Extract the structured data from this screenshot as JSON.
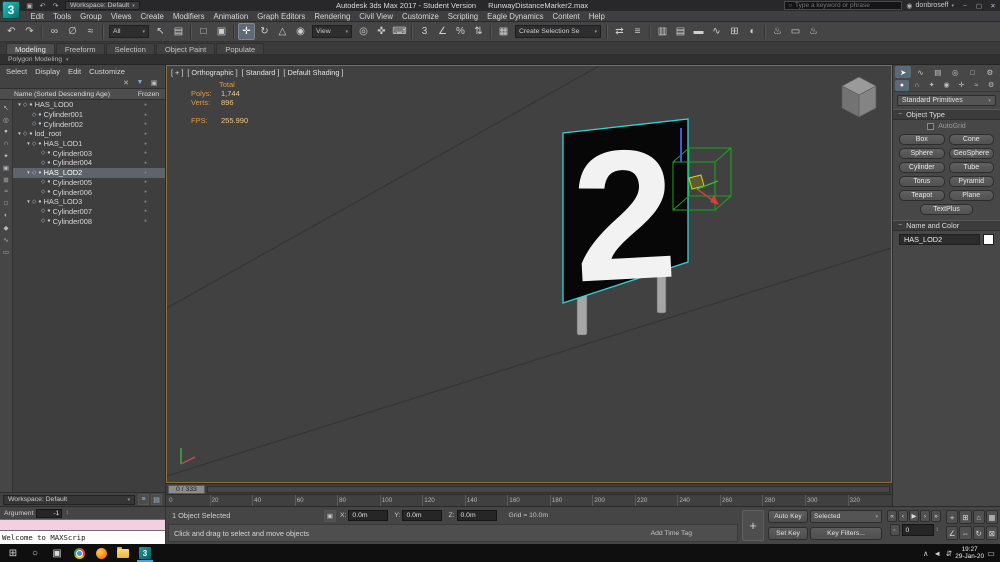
{
  "title_bar": {
    "logo_text": "3",
    "qat_icons": [
      {
        "name": "save-icon",
        "glyph": "▣"
      },
      {
        "name": "undo-quick-icon",
        "glyph": "↶"
      },
      {
        "name": "redo-quick-icon",
        "glyph": "↷"
      }
    ],
    "workspace_label": "Workspace: Default",
    "app_title": "Autodesk 3ds Max 2017 - Student Version",
    "doc_title": "RunwayDistanceMarker2.max",
    "search_placeholder": "Type a keyword or phrase",
    "user_name": "donbroseff",
    "window_controls": [
      {
        "name": "minimize-button",
        "glyph": "–"
      },
      {
        "name": "maximize-button",
        "glyph": "▢"
      },
      {
        "name": "close-button",
        "glyph": "✕"
      }
    ]
  },
  "menu_bar": {
    "items": [
      "Edit",
      "Tools",
      "Group",
      "Views",
      "Create",
      "Modifiers",
      "Animation",
      "Graph Editors",
      "Rendering",
      "Civil View",
      "Customize",
      "Scripting",
      "Eagle Dynamics",
      "Content",
      "Help"
    ]
  },
  "toolbar": {
    "items": [
      {
        "name": "undo-icon",
        "glyph": "↶"
      },
      {
        "name": "redo-icon",
        "glyph": "↷"
      },
      {
        "sep": true
      },
      {
        "name": "select-and-link-icon",
        "glyph": "∞"
      },
      {
        "name": "unlink-selection-icon",
        "glyph": "∅"
      },
      {
        "name": "bind-to-space-warp-icon",
        "glyph": "≈"
      },
      {
        "sep": true
      },
      {
        "name": "selection-filter-dropdown",
        "text": "All",
        "dropdown": true
      },
      {
        "name": "select-object-icon",
        "glyph": "↖"
      },
      {
        "name": "select-by-name-icon",
        "glyph": "▤"
      },
      {
        "sep": true
      },
      {
        "name": "selection-region-icon",
        "glyph": "□"
      },
      {
        "name": "window-crossing-icon",
        "glyph": "▣"
      },
      {
        "sep": true
      },
      {
        "name": "select-and-move-icon",
        "glyph": "✛",
        "active": true
      },
      {
        "name": "select-and-rotate-icon",
        "glyph": "↻"
      },
      {
        "name": "select-and-scale-icon",
        "glyph": "△"
      },
      {
        "name": "select-and-place-icon",
        "glyph": "◉"
      },
      {
        "name": "reference-coordinate-dropdown",
        "text": "View",
        "dropdown": true
      },
      {
        "name": "use-pivot-center-icon",
        "glyph": "◎"
      },
      {
        "name": "select-and-manipulate-icon",
        "glyph": "✜"
      },
      {
        "name": "keyboard-shortcut-override-icon",
        "glyph": "⌨"
      },
      {
        "sep": true
      },
      {
        "name": "snaps-toggle-icon",
        "glyph": "3"
      },
      {
        "name": "angle-snap-icon",
        "glyph": "∠"
      },
      {
        "name": "percent-snap-icon",
        "glyph": "%"
      },
      {
        "name": "spinner-snap-icon",
        "glyph": "⇅"
      },
      {
        "sep": true
      },
      {
        "name": "edit-named-selection-sets-icon",
        "glyph": "▦"
      },
      {
        "name": "named-selection-sets-dropdown",
        "text": "Create Selection Se",
        "dropdown": true,
        "wide": true
      },
      {
        "sep": true
      },
      {
        "name": "mirror-icon",
        "glyph": "⇄"
      },
      {
        "name": "align-icon",
        "glyph": "≡"
      },
      {
        "sep": true
      },
      {
        "name": "toggle-scene-explorer-icon",
        "glyph": "▥"
      },
      {
        "name": "toggle-layer-explorer-icon",
        "glyph": "▤"
      },
      {
        "name": "toggle-ribbon-icon",
        "glyph": "▬"
      },
      {
        "name": "curve-editor-icon",
        "glyph": "∿"
      },
      {
        "name": "schematic-view-icon",
        "glyph": "⊞"
      },
      {
        "name": "material-editor-icon",
        "glyph": "◐"
      },
      {
        "sep": true
      },
      {
        "name": "render-setup-icon",
        "glyph": "♨"
      },
      {
        "name": "rendered-frame-window-icon",
        "glyph": "▭"
      },
      {
        "name": "render-production-icon",
        "glyph": "♨"
      }
    ]
  },
  "ribbon": {
    "tabs": [
      {
        "label": "Modeling",
        "active": true
      },
      {
        "label": "Freeform"
      },
      {
        "label": "Selection"
      },
      {
        "label": "Object Paint"
      },
      {
        "label": "Populate"
      }
    ],
    "panel_strip": "Polygon Modeling"
  },
  "scene_explorer": {
    "menus": [
      "Select",
      "Display",
      "Edit",
      "Customize"
    ],
    "tools": [
      {
        "name": "clear-filter-icon",
        "glyph": "✕"
      },
      {
        "name": "filter-combinations-icon",
        "glyph": "▼"
      },
      {
        "name": "lock-explorer-icon",
        "glyph": "▣"
      }
    ],
    "header_name": "Name (Sorted Descending Age)",
    "header_frozen": "Frozen",
    "side_icons": [
      {
        "name": "explorer-select-icon",
        "glyph": "↖"
      },
      {
        "name": "explorer-find-icon",
        "glyph": "◎"
      },
      {
        "name": "display-geometry-icon",
        "glyph": "●"
      },
      {
        "name": "display-shapes-icon",
        "glyph": "∩"
      },
      {
        "name": "display-lights-icon",
        "glyph": "✦"
      },
      {
        "name": "display-cameras-icon",
        "glyph": "▣"
      },
      {
        "name": "display-helpers-icon",
        "glyph": "⊞"
      },
      {
        "name": "display-spacewarps-icon",
        "glyph": "≈"
      },
      {
        "name": "display-groups-icon",
        "glyph": "□"
      },
      {
        "name": "display-xrefs-icon",
        "glyph": "◐"
      },
      {
        "name": "display-materials-icon",
        "glyph": "◆"
      },
      {
        "name": "display-bones-icon",
        "glyph": "∿"
      },
      {
        "name": "display-containers-icon",
        "glyph": "▭"
      }
    ],
    "items": [
      {
        "label": "HAS_LOD0",
        "depth": 0,
        "parent": true
      },
      {
        "label": "Cylinder001",
        "depth": 1
      },
      {
        "label": "Cylinder002",
        "depth": 1
      },
      {
        "label": "lod_root",
        "depth": 0,
        "parent": true
      },
      {
        "label": "HAS_LOD1",
        "depth": 1,
        "parent": true
      },
      {
        "label": "Cylinder003",
        "depth": 2
      },
      {
        "label": "Cylinder004",
        "depth": 2
      },
      {
        "label": "HAS_LOD2",
        "depth": 1,
        "parent": true,
        "selected": true
      },
      {
        "label": "Cylinder005",
        "depth": 2
      },
      {
        "label": "Cylinder006",
        "depth": 2
      },
      {
        "label": "HAS_LOD3",
        "depth": 1,
        "parent": true
      },
      {
        "label": "Cylinder007",
        "depth": 2
      },
      {
        "label": "Cylinder008",
        "depth": 2
      }
    ]
  },
  "viewport": {
    "label_segments": [
      {
        "name": "viewport-general-menu",
        "text": "[ + ]"
      },
      {
        "name": "viewport-pov-menu",
        "text": "[ Orthographic ]"
      },
      {
        "name": "viewport-renderer-menu",
        "text": "[ Standard ]"
      },
      {
        "name": "viewport-shading-menu",
        "text": "[ Default Shading ]"
      }
    ],
    "stats": {
      "total_label": "Total",
      "rows": [
        {
          "label": "Polys:",
          "value": "1,744"
        },
        {
          "label": "Verts:",
          "value": "896"
        }
      ],
      "fps_label": "FPS:",
      "fps_value": "255.990"
    },
    "sign_number": "2"
  },
  "command_panel": {
    "tabs": [
      {
        "name": "tab-create",
        "glyph": "➤",
        "active": true
      },
      {
        "name": "tab-modify",
        "glyph": "∿"
      },
      {
        "name": "tab-hierarchy",
        "glyph": "▤"
      },
      {
        "name": "tab-motion",
        "glyph": "◎"
      },
      {
        "name": "tab-display",
        "glyph": "□"
      },
      {
        "name": "tab-utilities",
        "glyph": "⚙"
      }
    ],
    "categories": [
      {
        "name": "category-geometry",
        "glyph": "●",
        "active": true
      },
      {
        "name": "category-shapes",
        "glyph": "∩"
      },
      {
        "name": "category-lights",
        "glyph": "✦"
      },
      {
        "name": "category-cameras",
        "glyph": "◉"
      },
      {
        "name": "category-helpers",
        "glyph": "✛"
      },
      {
        "name": "category-spacewarps",
        "glyph": "≈"
      },
      {
        "name": "category-systems",
        "glyph": "⚙"
      }
    ],
    "dropdown_value": "Standard Primitives",
    "rollout_object_type": "Object Type",
    "autogrid_label": "AutoGrid",
    "buttons": [
      {
        "name": "box-button",
        "label": "Box"
      },
      {
        "name": "cone-button",
        "label": "Cone"
      },
      {
        "name": "sphere-button",
        "label": "Sphere"
      },
      {
        "name": "geosphere-button",
        "label": "GeoSphere"
      },
      {
        "name": "cylinder-button",
        "label": "Cylinder"
      },
      {
        "name": "tube-button",
        "label": "Tube"
      },
      {
        "name": "torus-button",
        "label": "Torus"
      },
      {
        "name": "pyramid-button",
        "label": "Pyramid"
      },
      {
        "name": "teapot-button",
        "label": "Teapot"
      },
      {
        "name": "plane-button",
        "label": "Plane"
      }
    ],
    "textplus_label": "TextPlus",
    "rollout_name_color": "Name and Color",
    "name_value": "HAS_LOD2"
  },
  "timeline": {
    "slider_value": "0 / 333",
    "ticks": [
      "0",
      "20",
      "40",
      "60",
      "80",
      "100",
      "120",
      "140",
      "160",
      "180",
      "200",
      "220",
      "240",
      "260",
      "280",
      "300",
      "320"
    ]
  },
  "footer": {
    "workspace_label": "Workspace: Default",
    "icons": [
      {
        "name": "workspace-settings-icon",
        "glyph": "≡"
      },
      {
        "name": "workspace-grid-icon",
        "glyph": "▤"
      }
    ]
  },
  "status_bar": {
    "argument_label": "Argument",
    "argument_value": "-1",
    "spinner_glyph": "↕",
    "listener_text": "Welcome to MAXScrip",
    "selection_text": "1 Object Selected",
    "prompt_text": "Click and drag to select and move objects",
    "lock_glyph": "▣",
    "coords": [
      {
        "name": "x-coordinate-field",
        "label": "X:",
        "value": "0.0m"
      },
      {
        "name": "y-coordinate-field",
        "label": "Y:",
        "value": "0.0m"
      },
      {
        "name": "z-coordinate-field",
        "label": "Z:",
        "value": "0.0m"
      }
    ],
    "grid_text": "Grid = 10.0m",
    "add_time_tag": "Add Time Tag",
    "plus_glyph": "+",
    "auto_key": "Auto Key",
    "set_key": "Set Key",
    "selected_value": "Selected",
    "key_filters": "Key Filters...",
    "frame_value": "0",
    "playback": [
      {
        "name": "go-to-start-button",
        "glyph": "«"
      },
      {
        "name": "previous-frame-button",
        "glyph": "‹"
      },
      {
        "name": "play-button",
        "glyph": "▶"
      },
      {
        "name": "next-frame-button",
        "glyph": "›"
      },
      {
        "name": "go-to-end-button",
        "glyph": "»"
      }
    ],
    "key_mode_glyph": "◦",
    "nav": [
      {
        "name": "zoom-button",
        "glyph": "+"
      },
      {
        "name": "zoom-all-button",
        "glyph": "⊞"
      },
      {
        "name": "zoom-extents-button",
        "glyph": "⌂"
      },
      {
        "name": "zoom-extents-all-button",
        "glyph": "▦"
      },
      {
        "name": "field-of-view-button",
        "glyph": "∠"
      },
      {
        "name": "pan-button",
        "glyph": "⇔"
      },
      {
        "name": "orbit-button",
        "glyph": "↻"
      },
      {
        "name": "maximize-viewport-button",
        "glyph": "⊠"
      }
    ]
  },
  "taskbar": {
    "apps": [
      {
        "name": "start-button",
        "type": "glyph",
        "glyph": "⊞"
      },
      {
        "name": "taskbar-search-button",
        "type": "glyph",
        "glyph": "○"
      },
      {
        "name": "task-view-button",
        "type": "glyph",
        "glyph": "▣"
      },
      {
        "name": "chrome-icon",
        "type": "chrome"
      },
      {
        "name": "firefox-icon",
        "type": "firefox"
      },
      {
        "name": "file-explorer-icon",
        "type": "folder"
      },
      {
        "name": "3ds-max-taskbar-icon",
        "type": "max",
        "label": "3",
        "active": true
      }
    ],
    "tray": [
      {
        "name": "tray-chevron-icon",
        "glyph": "∧"
      },
      {
        "name": "volume-icon",
        "glyph": "◄"
      },
      {
        "name": "network-icon",
        "glyph": "⇵"
      }
    ],
    "time": "19:27",
    "date": "29-Jan-20",
    "notification_glyph": "▭"
  },
  "colors": {
    "selection_cyan": "#2bd8d8",
    "gizmo_green": "#1aa51a",
    "stats_orange": "#e39b3b",
    "listener_pink": "#f3cfe3",
    "max_teal": "#0b6d6a"
  }
}
